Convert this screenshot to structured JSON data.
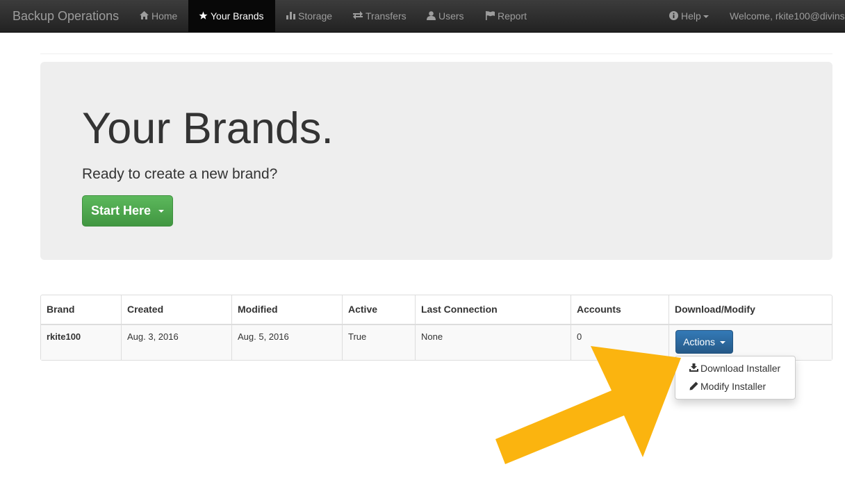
{
  "navbar": {
    "brand": "Backup Operations",
    "items": [
      {
        "label": "Home",
        "icon": "home-icon"
      },
      {
        "label": "Your Brands",
        "icon": "star-icon",
        "active": true
      },
      {
        "label": "Storage",
        "icon": "bar-chart-icon"
      },
      {
        "label": "Transfers",
        "icon": "transfer-icon"
      },
      {
        "label": "Users",
        "icon": "user-icon"
      },
      {
        "label": "Report",
        "icon": "flag-icon"
      }
    ],
    "help": {
      "label": "Help",
      "icon": "info-circle-icon"
    },
    "welcome": "Welcome, rkite100@divins"
  },
  "jumbotron": {
    "title": "Your Brands.",
    "subtitle": "Ready to create a new brand?",
    "button_label": "Start Here"
  },
  "table": {
    "columns": [
      "Brand",
      "Created",
      "Modified",
      "Active",
      "Last Connection",
      "Accounts",
      "Download/Modify"
    ],
    "rows": [
      {
        "brand": "rkite100",
        "created": "Aug. 3, 2016",
        "modified": "Aug. 5, 2016",
        "active": "True",
        "last_connection": "None",
        "accounts": "0",
        "action_label": "Actions"
      }
    ]
  },
  "dropdown": {
    "items": [
      {
        "label": "Download Installer",
        "icon": "download-icon"
      },
      {
        "label": "Modify Installer",
        "icon": "pencil-icon"
      }
    ]
  },
  "colors": {
    "navbar_bg": "#222222",
    "success": "#5cb85c",
    "primary": "#337ab7",
    "arrow": "#fbb40f"
  }
}
